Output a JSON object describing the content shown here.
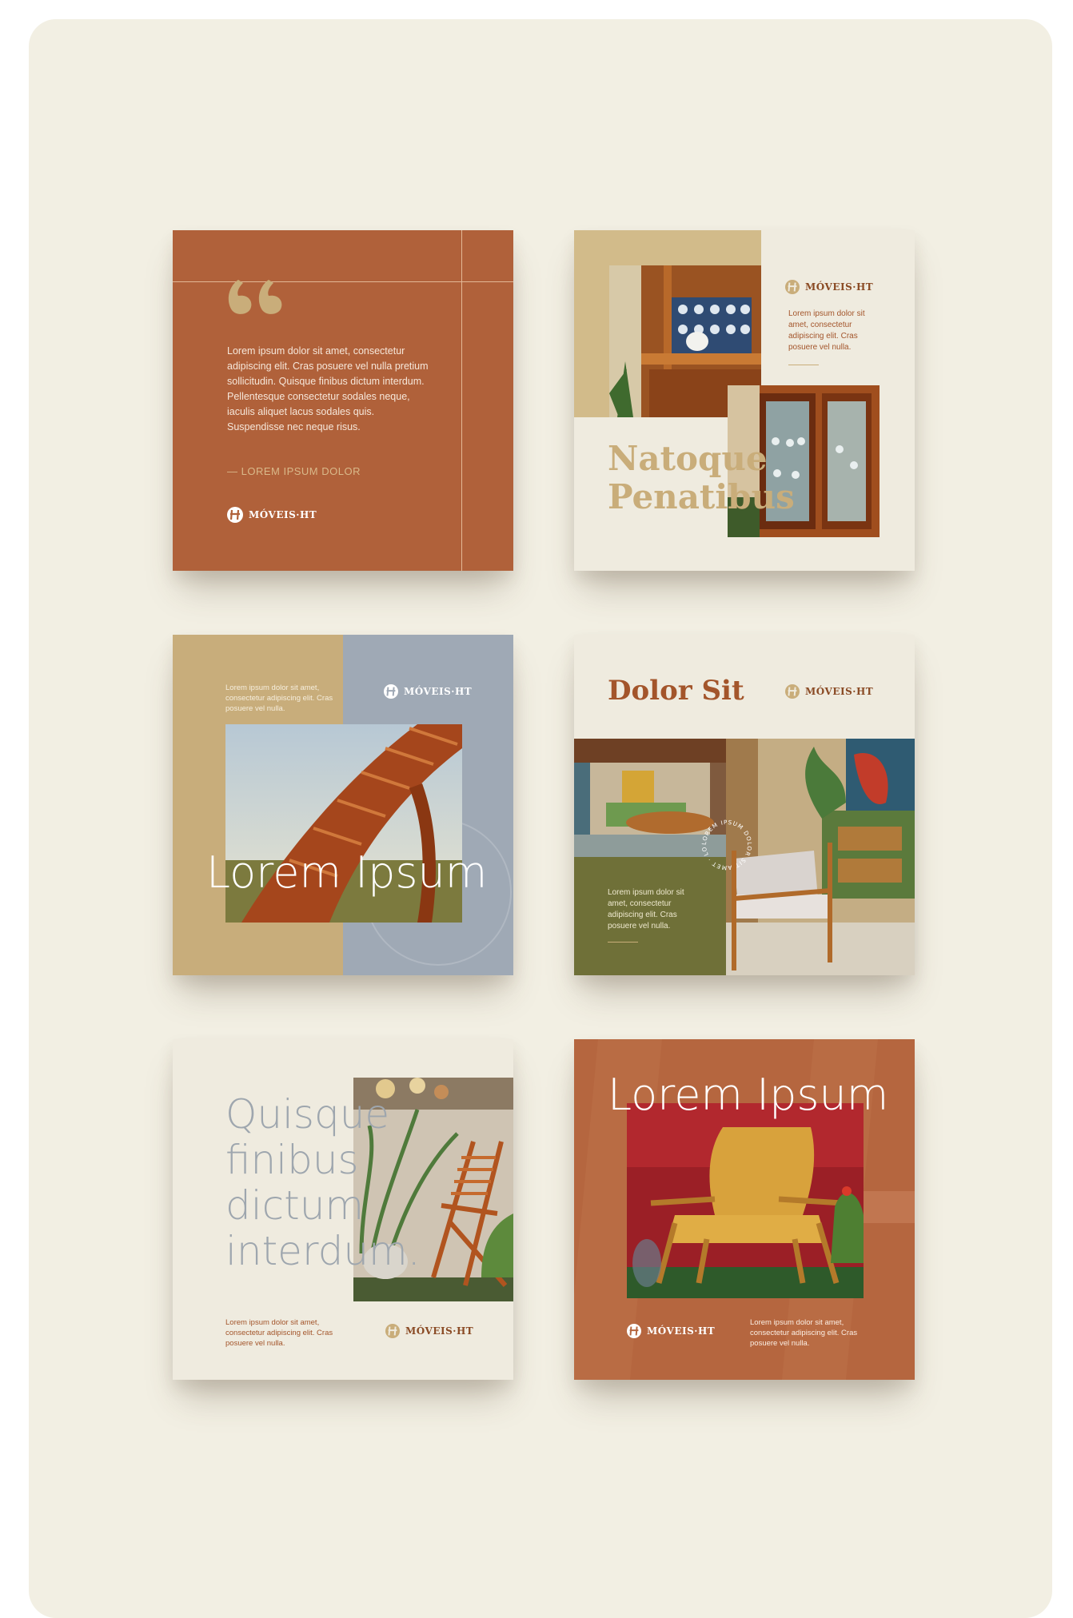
{
  "brand": {
    "name": "MÓVEIS·HT"
  },
  "colors": {
    "terracotta": "#b0613a",
    "cream": "#efebdf",
    "sand": "#c8ad7b",
    "slate": "#9fa9b5",
    "olive": "#6f7038",
    "gold": "#c9ad7a"
  },
  "card1": {
    "quote_icon": "quote-icon",
    "body": "Lorem ipsum dolor sit amet, consectetur adipiscing elit. Cras posuere vel nulla pretium sollicitudin. Quisque finibus dictum interdum. Pellentesque consectetur sodales neque, iaculis aliquet lacus sodales quis. Suspendisse nec neque risus.",
    "attribution": "— LOREM IPSUM DOLOR"
  },
  "card2": {
    "text": "Lorem ipsum dolor sit amet, consectetur adipiscing elit. Cras posuere vel nulla.",
    "title_line1": "Natoque",
    "title_line2": "Penatibus"
  },
  "card3": {
    "text": "Lorem ipsum dolor sit amet, consectetur adipiscing elit. Cras posuere vel nulla.",
    "title": "Lorem Ipsum",
    "watermark": "MÓVEIS·HT"
  },
  "card4": {
    "title": "Dolor Sit",
    "text": "Lorem ipsum dolor sit amet, consectetur adipiscing elit. Cras posuere vel nulla.",
    "circle_text": "LOREM IPSUM DOLOR SIT AMET · LOREM IPSUM DOLOR ·"
  },
  "card5": {
    "title_lines": [
      "Quisque",
      "finibus",
      "dictum",
      "interdum."
    ],
    "text": "Lorem ipsum dolor sit amet, consectetur adipiscing elit. Cras posuere vel nulla."
  },
  "card6": {
    "title": "Lorem Ipsum",
    "text": "Lorem ipsum dolor sit amet, consectetur adipiscing elit. Cras posuere vel nulla."
  }
}
